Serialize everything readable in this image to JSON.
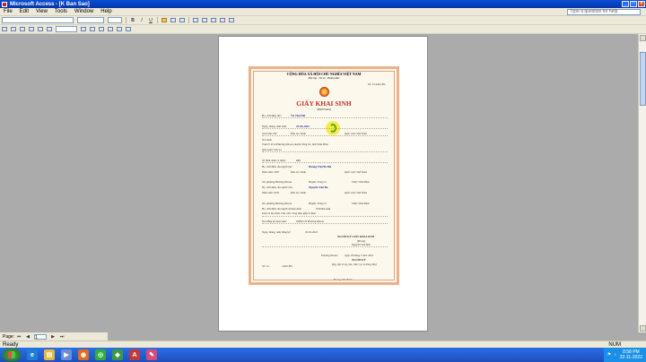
{
  "window": {
    "title": "Microsoft Access - [K Ban Sao]"
  },
  "menu": {
    "items": [
      "File",
      "Edit",
      "View",
      "Tools",
      "Window",
      "Help"
    ],
    "help_placeholder": "Type a question for help"
  },
  "statusbar": {
    "page_label": "Page:",
    "page_value": "1",
    "ready": "Ready",
    "num": "NUM"
  },
  "taskbar": {
    "time": "8:58 PM",
    "date": "22-11-2022"
  },
  "certificate": {
    "header1": "CỘNG HÒA XÃ HỘI CHỦ NGHĨA VIỆT NAM",
    "header2": "Độc lập - Tự do - Hạnh phúc",
    "so_label": "Số: 23-GKS-BC",
    "title": "GIẤY KHAI SINH",
    "subtitle": "(BẢN SAO)",
    "name_label": "Họ, chữ đệm, tên: ",
    "name": "Vũ Thu Hải",
    "dob_label": "Ngày, tháng, năm sinh:",
    "dob": "25-06-2022",
    "gender_label": "Giới tính: Nữ",
    "ethnic_label": "Dân tộc: Kinh",
    "nationality_label": "Quốc tịch: Việt Nam",
    "birthplace_label": "Nơi sinh:",
    "birthplace": "Trạm Y tế xã Phương Khoan, huyện Sông Lô, tỉnh Vĩnh Phúc",
    "hometown_label": "Quê quán: Sơn La",
    "id_label": "Số định danh cá nhân:",
    "id": "222",
    "mother_label": "Họ, chữ đệm, tên người mẹ:",
    "mother": "Hoàng Thị Hà Nhi",
    "mother_year": "Năm sinh: 1987",
    "mother_ethnic": "Dân tộc: Kinh",
    "mother_nat": "Quốc tịch: Việt Nam",
    "mother_res": "Xã, phường Phương Khoan",
    "mother_district": "Huyện: Sông Lô",
    "mother_province": "Tỉnh: Vĩnh Phúc",
    "father_label": "Họ, chữ đệm, tên người cha:",
    "father": "Nguyễn Văn Ba",
    "father_year": "Năm sinh: 1970",
    "father_ethnic": "Dân tộc: Kinh",
    "father_nat": "Quốc tịch: Việt Nam",
    "father_res": "Xã, phường Phương Khoan",
    "father_district": "Huyện: Sông Lô",
    "father_province": "Tỉnh: Vĩnh Phúc",
    "declarant_label": "Họ, chữ đệm, tên người đi khai sinh:",
    "declarant": "Vũ Đình Anh",
    "declarant_doc": "Giấy tờ tùy thân: Căn cước công dân, giấy tờ khác",
    "reg_place_label": "Nơi đăng ký khai sinh:",
    "reg_place": "UBND xã Phương Khoan",
    "reg_date_label": "Ngày, tháng, năm đăng ký:",
    "reg_date": "25-05-2022",
    "signer_title": "NGƯỜI KÝ GIẤY KHAI SINH",
    "signer_sub": "(Đã ký)",
    "signer_name": "Nguyễn Văn Đức",
    "copy_place": "Phương Khoan",
    "copy_date": "ngày 28 tháng 5 năm 2022",
    "copy_signer": "NGƯỜI KÝ",
    "copy_signer_sub": "(Ký, ghi rõ họ, tên, chức vụ và đóng dấu)",
    "book_no": "Số: 12",
    "book_ref": "/GKS-BS",
    "copy_signer_name": "Hoàng Văn Bách"
  }
}
